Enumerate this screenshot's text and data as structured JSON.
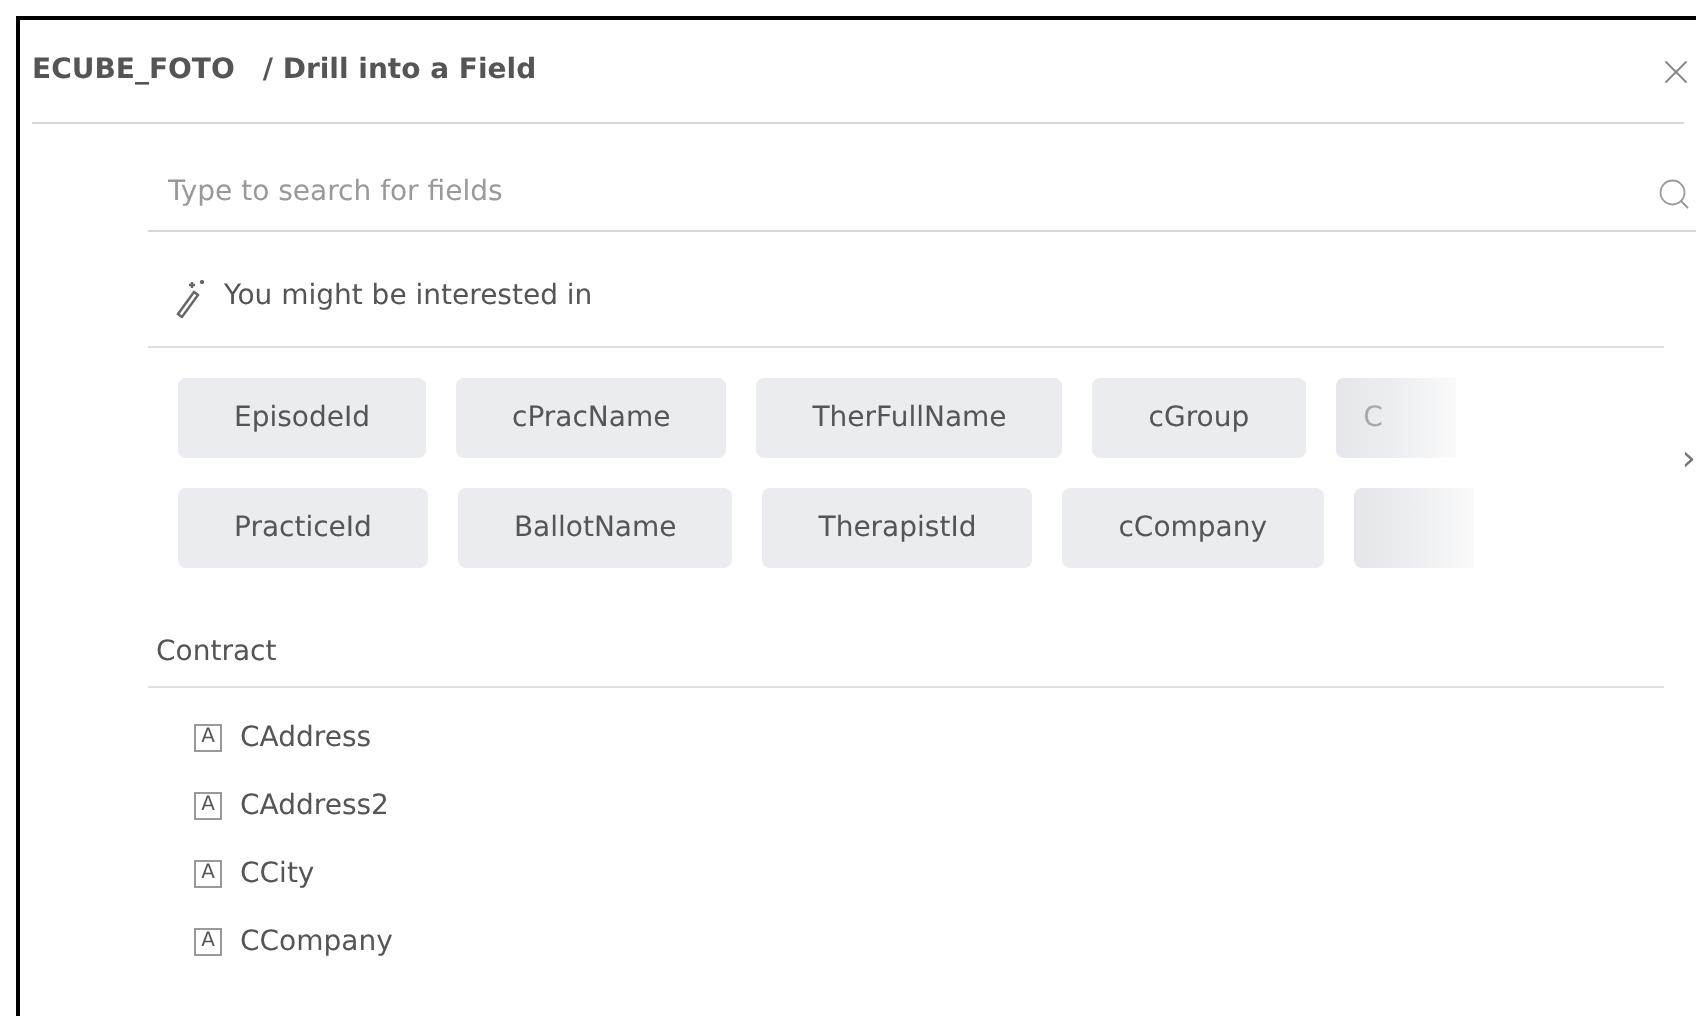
{
  "dialog": {
    "dataset": "ECUBE_FOTO",
    "title": "/ Drill into a Field"
  },
  "search": {
    "placeholder": "Type to search for fields"
  },
  "suggestions": {
    "heading": "You might be interested in",
    "rows": [
      [
        {
          "label": "EpisodeId",
          "kind": "full"
        },
        {
          "label": "cPracName",
          "kind": "full"
        },
        {
          "label": "TherFullName",
          "kind": "full"
        },
        {
          "label": "cGroup",
          "kind": "full"
        },
        {
          "label": "C",
          "kind": "partial"
        }
      ],
      [
        {
          "label": "PracticeId",
          "kind": "full"
        },
        {
          "label": "BallotName",
          "kind": "full"
        },
        {
          "label": "TherapistId",
          "kind": "full"
        },
        {
          "label": "cCompany",
          "kind": "full"
        },
        {
          "kind": "partial"
        }
      ]
    ],
    "next": "›"
  },
  "sections": [
    {
      "name": "Contract",
      "fields": [
        {
          "type": "A",
          "name": "CAddress"
        },
        {
          "type": "A",
          "name": "CAddress2"
        },
        {
          "type": "A",
          "name": "CCity"
        },
        {
          "type": "A",
          "name": "CCompany"
        }
      ]
    }
  ]
}
